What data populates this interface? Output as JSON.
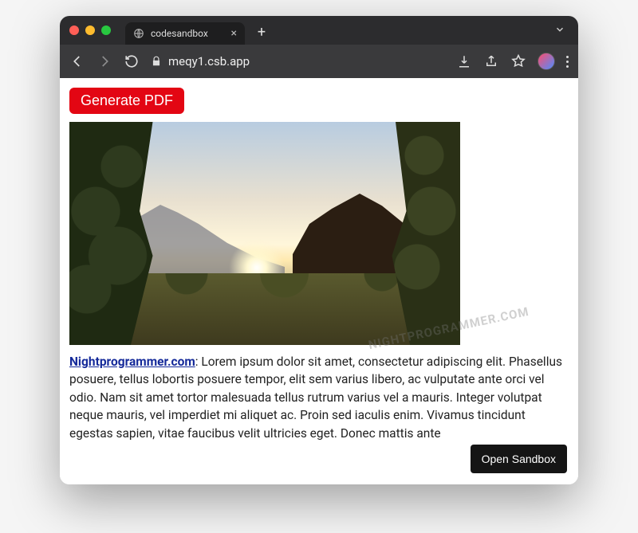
{
  "titlebar": {
    "tab_title": "codesandbox"
  },
  "toolbar": {
    "url_display": "meqy1.csb.app"
  },
  "page": {
    "generate_label": "Generate PDF",
    "link_text": "Nightprogrammer.com",
    "body_after_link": ": Lorem ipsum dolor sit amet, consectetur adipiscing elit. Phasellus posuere, tellus lobortis posuere tempor, elit sem varius libero, ac vulputate ante orci vel odio. Nam sit amet tortor malesuada tellus rutrum varius vel a mauris. Integer volutpat neque mauris, vel imperdiet mi aliquet ac. Proin sed iaculis enim. Vivamus tincidunt egestas sapien, vitae faucibus velit ultricies eget. Donec mattis ante",
    "watermark": "NIGHTPROGRAMMER.COM",
    "sandbox_label": "Open Sandbox"
  }
}
